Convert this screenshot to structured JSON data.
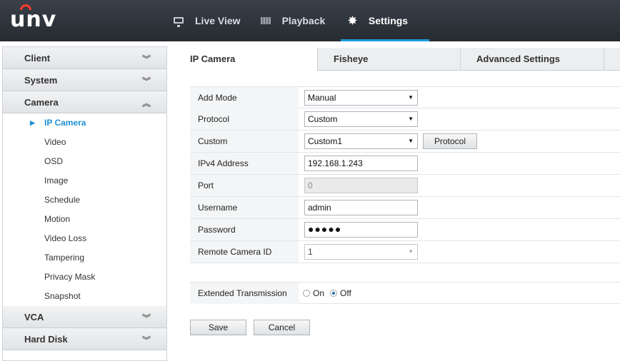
{
  "app": {
    "logo": "unv"
  },
  "nav": [
    {
      "label": "Live View",
      "icon": "monitor-icon"
    },
    {
      "label": "Playback",
      "icon": "film-icon"
    },
    {
      "label": "Settings",
      "icon": "gear-icon"
    }
  ],
  "sidebar": {
    "sections": [
      {
        "label": "Client",
        "expanded": false
      },
      {
        "label": "System",
        "expanded": false
      },
      {
        "label": "Camera",
        "expanded": true
      },
      {
        "label": "VCA",
        "expanded": false
      },
      {
        "label": "Hard Disk",
        "expanded": false
      }
    ],
    "camera_items": [
      "IP Camera",
      "Video",
      "OSD",
      "Image",
      "Schedule",
      "Motion",
      "Video Loss",
      "Tampering",
      "Privacy Mask",
      "Snapshot"
    ],
    "active_item": "IP Camera"
  },
  "tabs": [
    "IP Camera",
    "Fisheye",
    "Advanced Settings"
  ],
  "form": {
    "add_mode": {
      "label": "Add Mode",
      "value": "Manual"
    },
    "protocol": {
      "label": "Protocol",
      "value": "Custom"
    },
    "custom": {
      "label": "Custom",
      "value": "Custom1",
      "button": "Protocol"
    },
    "ipv4": {
      "label": "IPv4 Address",
      "value": "192.168.1.243"
    },
    "port": {
      "label": "Port",
      "value": "0"
    },
    "username": {
      "label": "Username",
      "value": "admin"
    },
    "password": {
      "label": "Password",
      "value": "●●●●●"
    },
    "remote_id": {
      "label": "Remote Camera ID",
      "value": "1"
    },
    "extended": {
      "label": "Extended Transmission",
      "on": "On",
      "off": "Off",
      "selected": "Off"
    }
  },
  "buttons": {
    "save": "Save",
    "cancel": "Cancel"
  },
  "colors": {
    "accent": "#1f9bdc",
    "logo_arc": "#ff3a2a",
    "topbar": "#2e343b"
  }
}
